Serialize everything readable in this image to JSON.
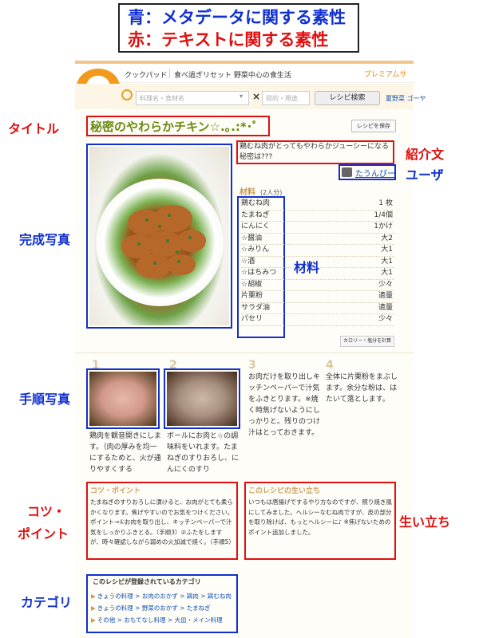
{
  "legend": {
    "line1": "青：メタデータに関する素性",
    "line2": "赤：テキストに関する素性"
  },
  "header": {
    "site_name": "クックパッド",
    "catchcopy": "食べ過ぎリセット 野菜中心の食生活",
    "premium": "プレミアムサ"
  },
  "search": {
    "keyword_placeholder": "料理名・食材名",
    "purpose_placeholder": "目的・用途",
    "button": "レシピ検索",
    "tags": "夏野菜 ゴーヤ"
  },
  "recipe": {
    "title": "秘密のやわらかチキン☆.｡.:*･ﾟ",
    "save_label": "レシピを保存",
    "intro": "鶏むね肉がとってもやわらかジューシーになる秘密は???",
    "user": "たうんぴー",
    "ingredients_heading": "材料",
    "servings": "(2人分)",
    "ingredients": [
      {
        "name": "鶏むね肉",
        "qty": "1 枚"
      },
      {
        "name": "たまねぎ",
        "qty": "1/4個"
      },
      {
        "name": "にんにく",
        "qty": "1かけ"
      },
      {
        "name": "☆醤油",
        "qty": "大2"
      },
      {
        "name": "☆みりん",
        "qty": "大1"
      },
      {
        "name": "☆酒",
        "qty": "大1"
      },
      {
        "name": "☆はちみつ",
        "qty": "大1"
      },
      {
        "name": "☆胡椒",
        "qty": "少々"
      },
      {
        "name": "片栗粉",
        "qty": "適量"
      },
      {
        "name": "サラダ油",
        "qty": "適量"
      },
      {
        "name": "パセリ",
        "qty": "少々"
      }
    ],
    "calorie_button": "カロリー・塩分を計算",
    "steps": [
      {
        "num": "1",
        "text": "鶏肉を観音開きにします。（肉の厚みを均一にするためと、火が通りやすくする"
      },
      {
        "num": "2",
        "text": "ボールにお肉と☆の調味料をいれます。たまねぎのすりおろし、にんにくのすり"
      },
      {
        "num": "3",
        "text": "お肉だけを取り出しキッチンペーパーで汁気をふきとります。※焼く時焦げないようにしっかりと。残りのつけ汁はとっておきます。"
      },
      {
        "num": "4",
        "text": "全体に片栗粉をまぶします。余分な粉は、はたいて落とします。"
      }
    ],
    "tips_title": "コツ・ポイント",
    "tips_text": "たまねぎのすりおろしに漬けると、お肉がとても柔らかくなります。焦げやすいのでお気をつけください。ポイント→①お肉を取り出し、キッチンペーパーで汁気をしっかりふきとる。（手順3）②ふたをしますが、時々確認しながら弱めの火加減で焼く。（手順5）",
    "story_title": "このレシピの生い立ち",
    "story_text": "いつもは唐揚げでするやり方なのですが、照り焼き風にしてみました。ヘルシーなむね肉ですが、皮の部分を取り除けば、もっとヘルシーに♪ ※焦げないためのポイント追加しました。",
    "category_title": "このレシピが登録されているカテゴリ",
    "categories": [
      "きょうの料理 > お肉のおかず > 鶏肉 > 鶏むね肉",
      "きょうの料理 > 野菜のおかず > たまねぎ",
      "その他 > おもてなし料理 > 大皿・メイン料理"
    ]
  },
  "annotations": {
    "title": "タイトル",
    "photo": "完成写真",
    "intro": "紹介文",
    "user": "ユーザ",
    "ingredients": "材料",
    "step_photo": "手順写真",
    "tips_line1": "コツ・",
    "tips_line2": "ポイント",
    "story": "生い立ち",
    "category": "カテゴリ"
  },
  "colors": {
    "red": "#e01010",
    "blue": "#1030d0",
    "title_green": "#6a8a10",
    "accent_orange": "#f29a1e"
  }
}
